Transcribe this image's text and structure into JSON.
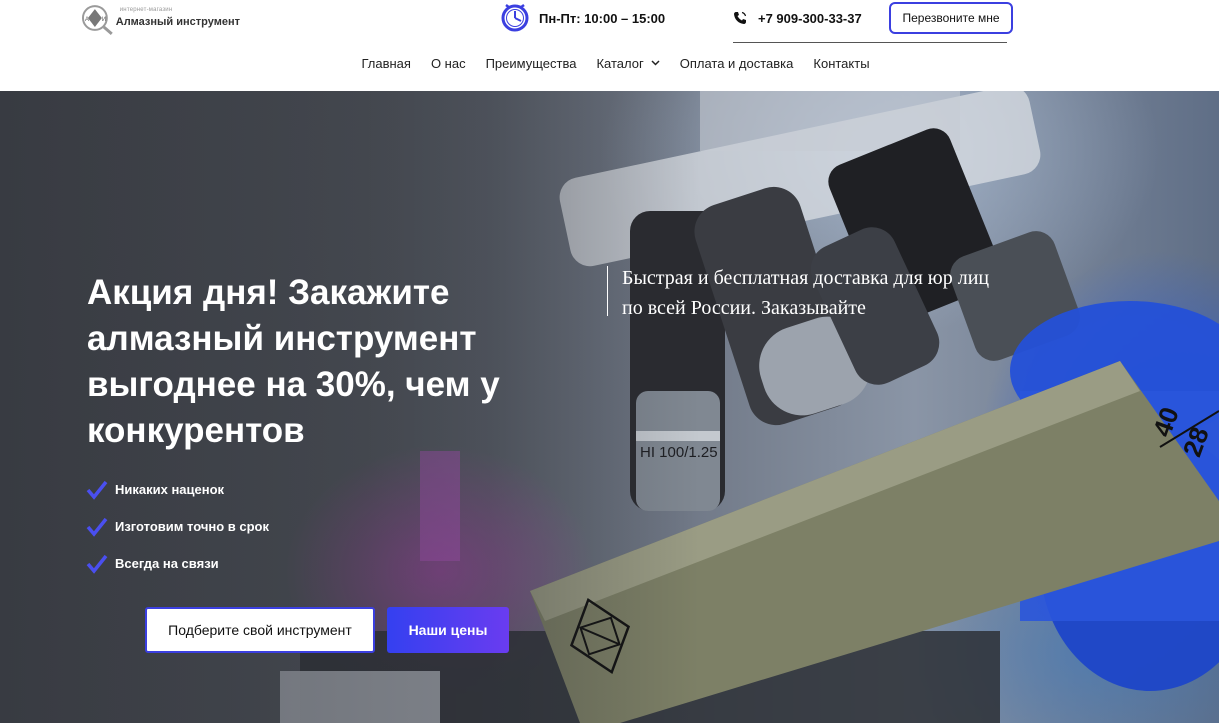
{
  "header": {
    "logo_subtitle": "интернет-магазин",
    "logo_text": "Алмазный инструмент",
    "hours": "Пн-Пт: 10:00 – 15:00",
    "phone": "+7 909-300-33-37",
    "callback_label": "Перезвоните мне"
  },
  "nav": {
    "items": [
      {
        "label": "Главная"
      },
      {
        "label": "О нас"
      },
      {
        "label": "Преимущества"
      },
      {
        "label": "Каталог"
      },
      {
        "label": "Оплата и доставка"
      },
      {
        "label": "Контакты"
      }
    ]
  },
  "hero": {
    "headline": "Акция дня! Закажите алмазный  инструмент выгоднее на 30%, чем у конкурентов",
    "features": [
      {
        "text": "Никаких наценок"
      },
      {
        "text": "Изготовим точно в срок"
      },
      {
        "text": "Всегда на связи"
      }
    ],
    "btn_pick_label": "Подберите свой инструмент",
    "btn_prices_label": "Наши цены",
    "promo_text": "Быстрая и бесплатная доставка для юр лиц по всей России. Заказывайте",
    "stone_label_top": "40",
    "stone_label_bottom": "28",
    "lens_label": "HI 100/1.25"
  },
  "colors": {
    "accent": "#3b3fe0",
    "accent_gradient_end": "#6a3cf0",
    "text_dark": "#111111",
    "hero_text": "#ffffff"
  }
}
